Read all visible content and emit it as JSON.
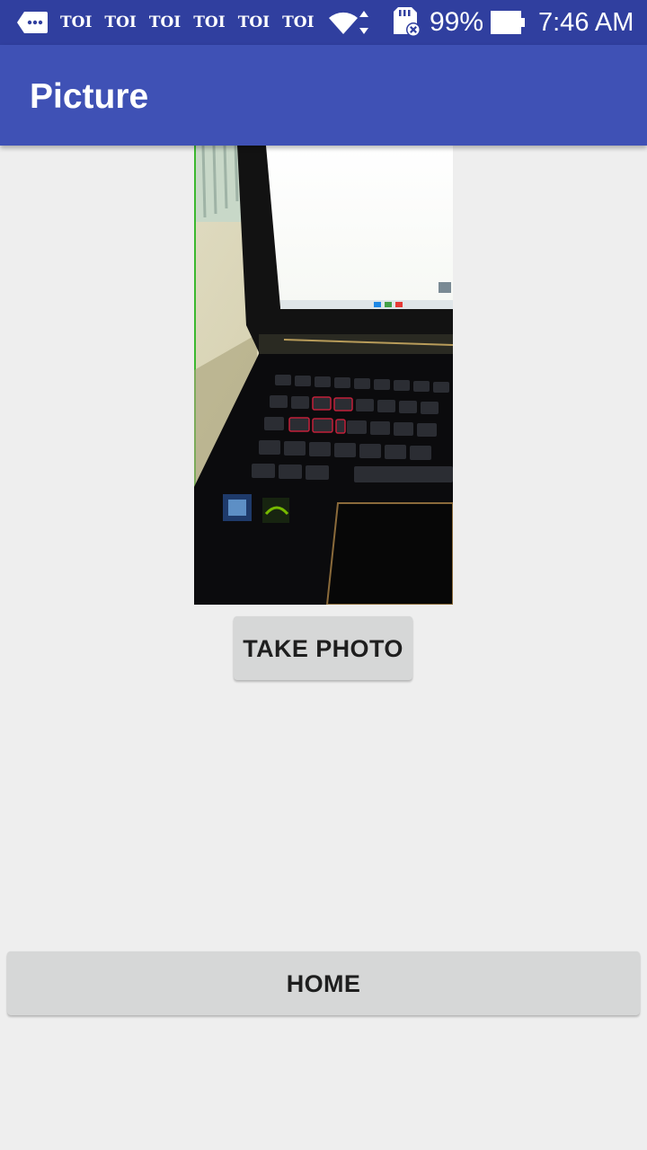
{
  "status_bar": {
    "notifications": [
      "TOI",
      "TOI",
      "TOI",
      "TOI",
      "TOI",
      "TOI"
    ],
    "battery_percent": "99%",
    "time": "7:46 AM",
    "icons": [
      "message-icon",
      "wifi-icon",
      "sd-card-error-icon",
      "battery-icon"
    ],
    "color": "#303f9f"
  },
  "app_bar": {
    "title": "Picture",
    "color": "#3f51b5"
  },
  "photo": {
    "description_icon": "captured-photo"
  },
  "buttons": {
    "take_photo": "TAKE PHOTO",
    "home": "HOME"
  }
}
